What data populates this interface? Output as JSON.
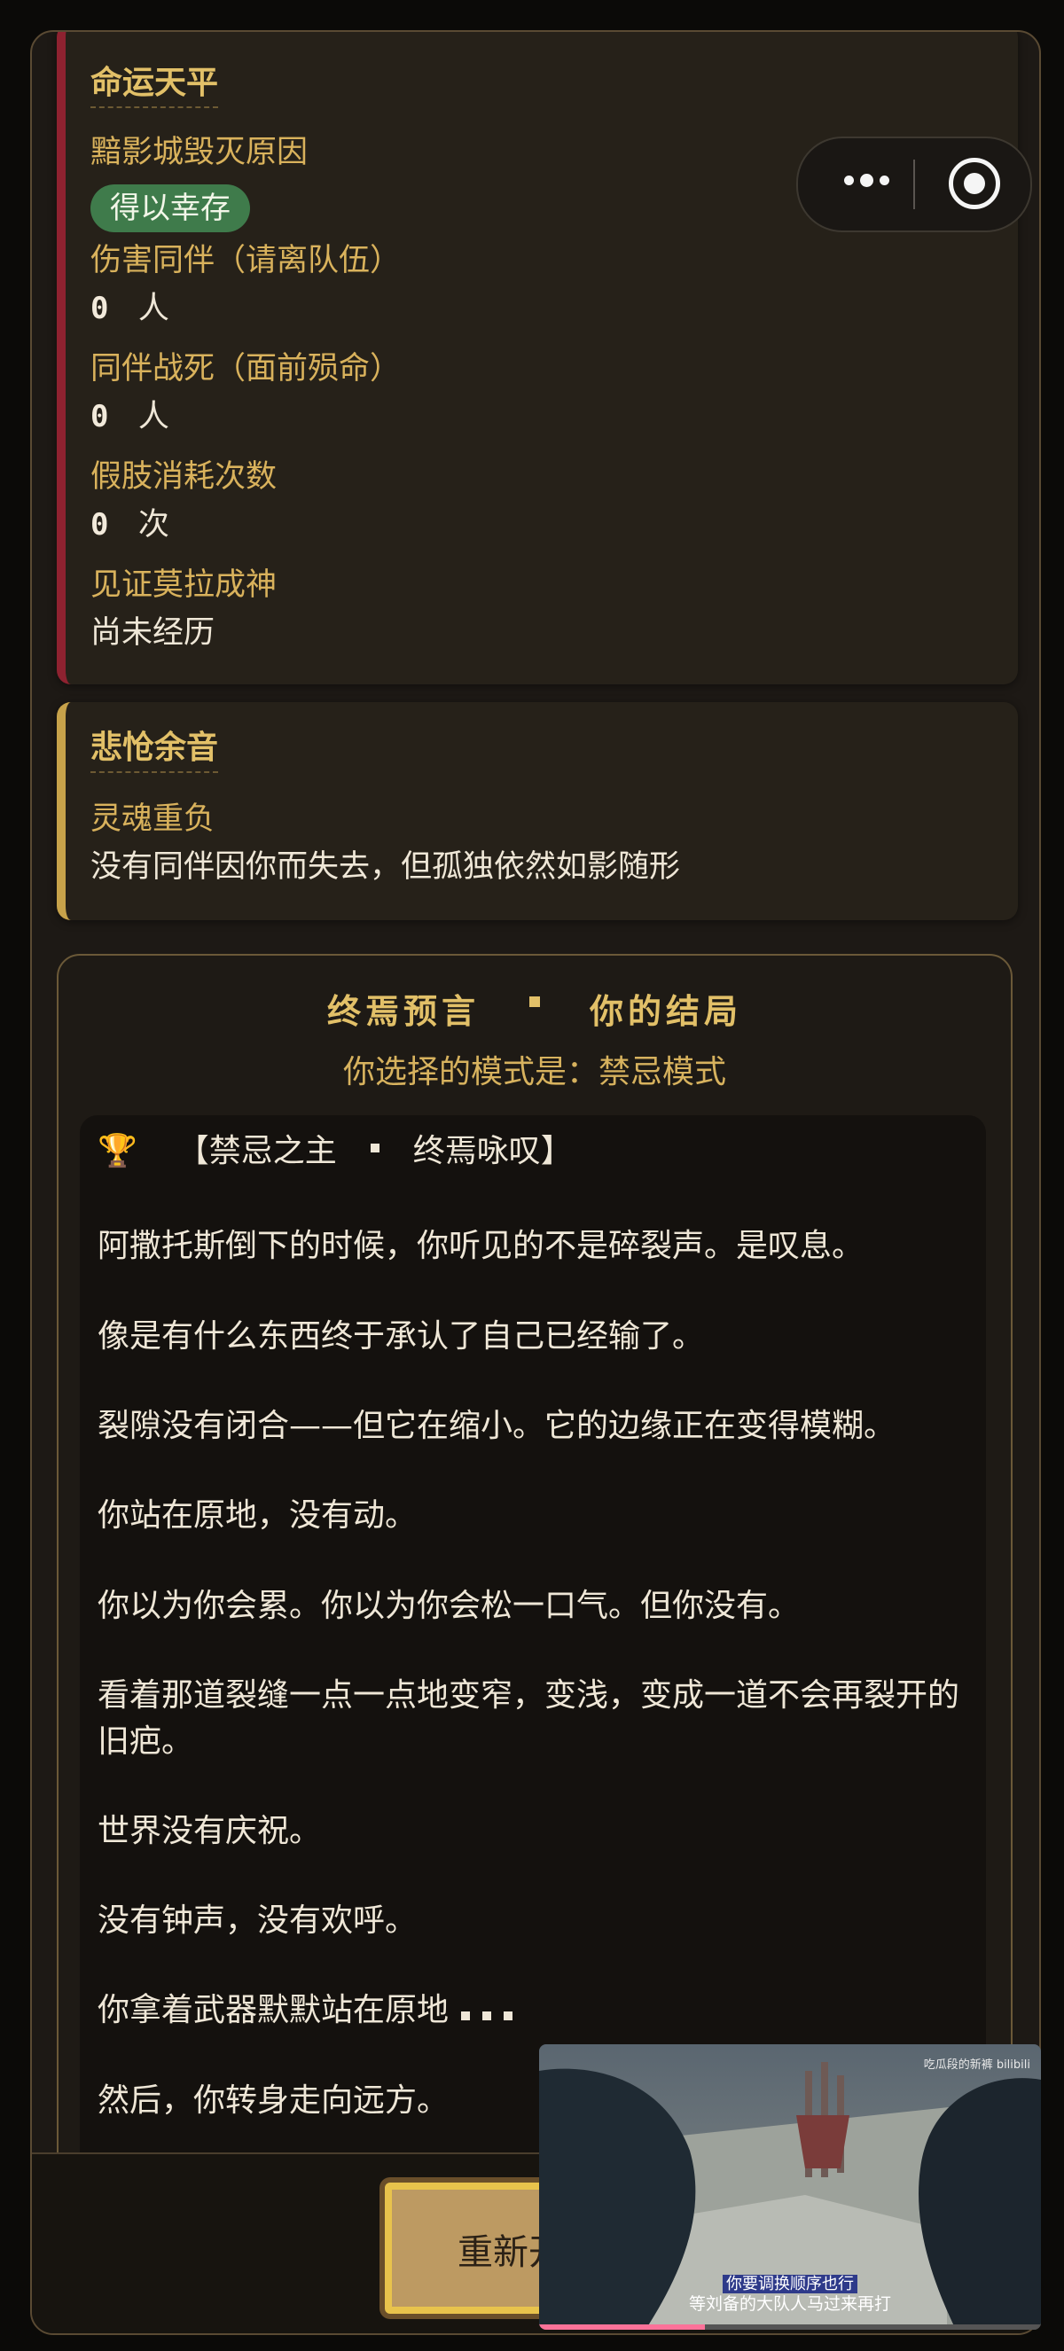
{
  "fate": {
    "title": "命运天平",
    "items": [
      {
        "label": "黯影城毁灭原因",
        "badge": "得以幸存"
      },
      {
        "label": "伤害同伴（请离队伍）",
        "number": "0",
        "unit": "人"
      },
      {
        "label": "同伴战死（面前殒命）",
        "number": "0",
        "unit": "人"
      },
      {
        "label": "假肢消耗次数",
        "number": "0",
        "unit": "次"
      },
      {
        "label": "见证莫拉成神",
        "value": "尚未经历"
      }
    ]
  },
  "echo": {
    "title": "悲怆余音",
    "label": "灵魂重负",
    "value": "没有同伴因你而失去，但孤独依然如影随形"
  },
  "ending": {
    "title_left": "终焉预言",
    "title_right": "你的结局",
    "mode": "你选择的模式是：禁忌模式",
    "heading_icon": "trophy-icon",
    "heading_icon_glyph": "🏆",
    "heading_left": "【禁忌之主",
    "heading_right": "终焉咏叹】",
    "paragraphs": [
      "阿撒托斯倒下的时候，你听见的不是碎裂声。是叹息。",
      "像是有什么东西终于承认了自己已经输了。",
      "裂隙没有闭合——但它在缩小。它的边缘正在变得模糊。",
      "你站在原地，没有动。",
      "你以为你会累。你以为你会松一口气。但你没有。",
      "看着那道裂缝一点一点地变窄，变浅，变成一道不会再裂开的旧疤。",
      "世界没有庆祝。",
      "没有钟声，没有欢呼。",
      "你拿着武器默默站在原地",
      "然后，你转身走向远方。"
    ]
  },
  "restart_label": "重新开",
  "capsule": {
    "more_icon": "more-dots-icon",
    "close_icon": "target-icon"
  },
  "video": {
    "brand": "吃瓜段的新裤 bilibili",
    "subtitle_top": "你要调换顺序也行",
    "subtitle_bottom": "等刘备的大队人马过来再打",
    "progress": 0.33
  },
  "colors": {
    "accent": "#e2c068",
    "fate_border": "#8e2230",
    "echo_border": "#c7a24a",
    "badge": "#3f7b4b"
  }
}
